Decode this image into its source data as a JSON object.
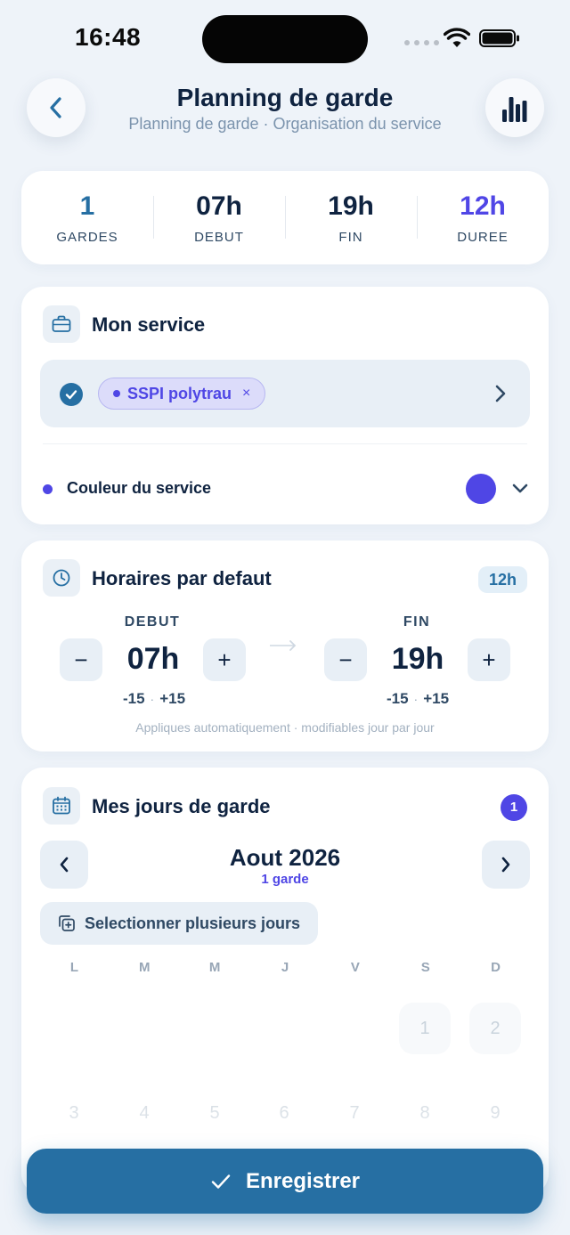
{
  "status_bar": {
    "time": "16:48"
  },
  "header": {
    "title": "Planning de garde",
    "subtitle": "Planning de garde · Organisation du service"
  },
  "summary": [
    {
      "value": "1",
      "label": "GARDES"
    },
    {
      "value": "07h",
      "label": "DEBUT"
    },
    {
      "value": "19h",
      "label": "FIN"
    },
    {
      "value": "12h",
      "label": "DUREE"
    }
  ],
  "service": {
    "title": "Mon service",
    "selected_chip": "SSPI polytrau",
    "chip_remove": "×",
    "color_label": "Couleur du service",
    "color": "#4f46e5"
  },
  "horaires": {
    "title": "Horaires par defaut",
    "duration_badge": "12h",
    "start": {
      "label": "DEBUT",
      "value": "07h",
      "minus": "−",
      "plus": "+",
      "adj_minus": "-15",
      "adj_plus": "+15"
    },
    "end": {
      "label": "FIN",
      "value": "19h",
      "minus": "−",
      "plus": "+",
      "adj_minus": "-15",
      "adj_plus": "+15"
    },
    "hint": "Appliques automatiquement · modifiables jour par jour"
  },
  "jours": {
    "title": "Mes jours de garde",
    "count_badge": "1",
    "month": "Aout 2026",
    "month_sub": "1 garde",
    "multi_select_label": "Selectionner plusieurs jours",
    "weekdays": [
      "L",
      "M",
      "M",
      "J",
      "V",
      "S",
      "D"
    ],
    "row1": [
      "1",
      "2"
    ],
    "row2": [
      "3",
      "4",
      "5",
      "6",
      "7",
      "8",
      "9"
    ]
  },
  "save_button": {
    "label": "Enregistrer"
  },
  "colors": {
    "primary": "#266fa3",
    "accent": "#4f46e5"
  }
}
